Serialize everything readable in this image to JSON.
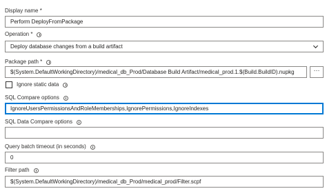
{
  "display_name": {
    "label": "Display name *",
    "value": "Perform DeployFromPackage"
  },
  "operation": {
    "label": "Operation *",
    "value": "Deploy database changes from a build artifact"
  },
  "package_path": {
    "label": "Package path *",
    "value": "$(System.DefaultWorkingDirectory)/medical_db_Prod/Database Build Artifact/medical_prod.1.$(Build.BuildID).nupkg",
    "browse_label": "···"
  },
  "ignore_static_data": {
    "label": "Ignore static data",
    "checked": false
  },
  "sql_compare_options": {
    "label": "SQL Compare options",
    "value": "IgnoreUsersPermissionsAndRoleMemberships,IgnorePermissions,IgnoreIndexes"
  },
  "sql_data_compare_options": {
    "label": "SQL Data Compare options",
    "value": ""
  },
  "query_batch_timeout": {
    "label": "Query batch timeout (in seconds)",
    "value": "0"
  },
  "filter_path": {
    "label": "Filter path",
    "value": "$(System.DefaultWorkingDirectory)/medical_db_Prod/medical_prod/Filter.scpf"
  },
  "icons": {
    "info": "info-icon",
    "dropdown": "chevron-down-icon",
    "browse": "more-icon"
  }
}
